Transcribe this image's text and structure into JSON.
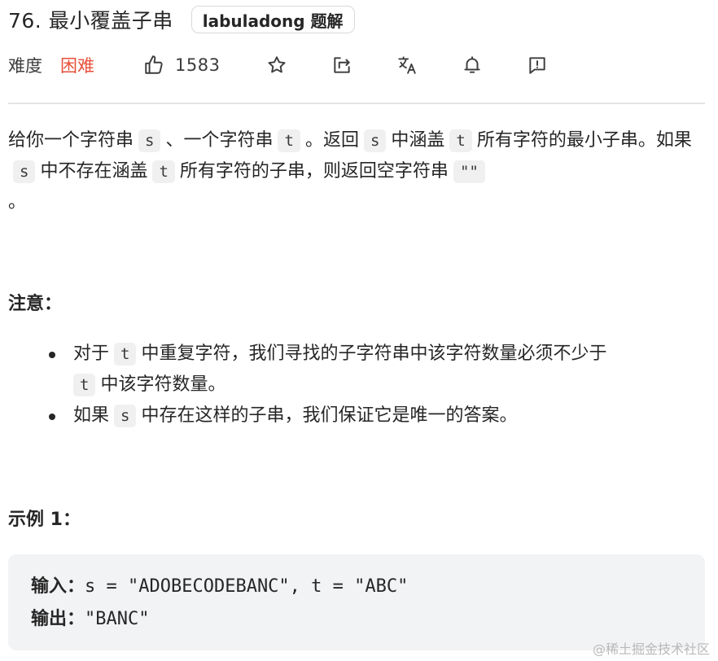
{
  "header": {
    "title": "76. 最小覆盖子串",
    "badge": "labuladong 题解"
  },
  "meta": {
    "difficulty_label": "难度",
    "difficulty_value": "困难",
    "likes": "1583",
    "icons": [
      "thumbs-up-icon",
      "star-icon",
      "share-icon",
      "translate-icon",
      "bell-icon",
      "feedback-icon"
    ]
  },
  "description": {
    "p1": "给你一个字符串",
    "code_s": "s",
    "p2": "、一个字符串",
    "code_t": "t",
    "p3": "。返回",
    "p4": "中涵盖",
    "p5": "所有字符的最小子串。如果",
    "p6": "中不存在涵盖",
    "p7": "所有字符的子串，则返回空字符串",
    "code_empty": "\"\"",
    "p8": "。"
  },
  "notes": {
    "heading": "注意：",
    "b1_a": "对于",
    "b1_b": "中重复字符，我们寻找的子字符串中该字符数量必须不少于",
    "b1_c": "中该字符数量。",
    "b2_a": "如果",
    "b2_b": "中存在这样的子串，我们保证它是唯一的答案。"
  },
  "example1": {
    "heading": "示例 1：",
    "input_label": "输入：",
    "input_value": "s = \"ADOBECODEBANC\", t = \"ABC\"",
    "output_label": "输出：",
    "output_value": "\"BANC\""
  },
  "watermark": "@稀土掘金技术社区",
  "colors": {
    "difficulty_hard": "#e8503a",
    "code_bg": "#f0f0f0",
    "example_bg": "#f2f3f5"
  }
}
